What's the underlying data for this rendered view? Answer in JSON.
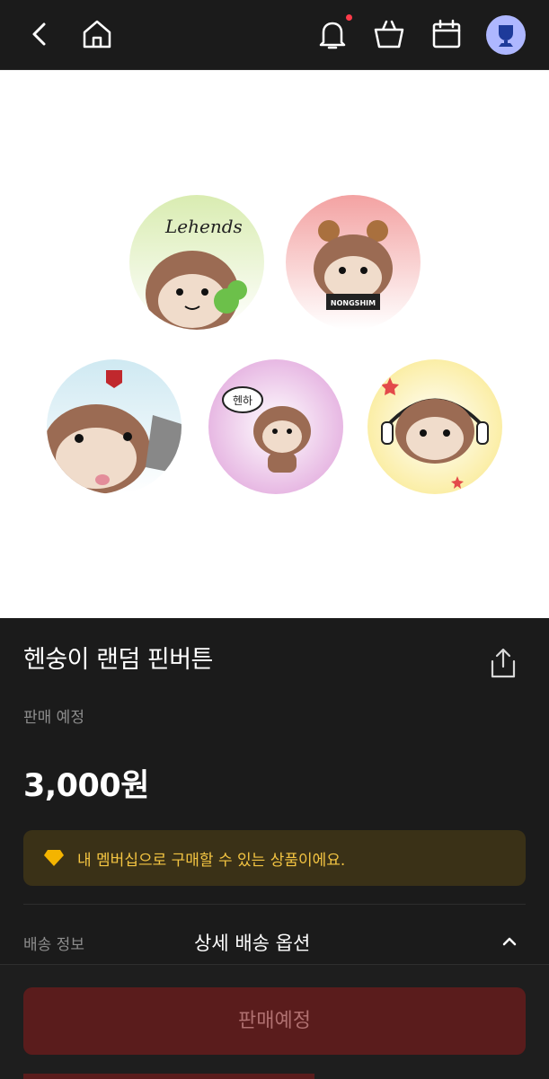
{
  "header": {
    "icons": [
      "back-icon",
      "home-icon",
      "bell-icon",
      "shopping-bag-icon",
      "calendar-icon",
      "avatar"
    ]
  },
  "product": {
    "title": "헨숭이 랜덤 핀버튼",
    "sale_status": "판매 예정",
    "price": "3,000원",
    "membership_notice": "내 멤버십으로 구매할 수 있는 상품이에요.",
    "badge_texts": [
      "Lehends",
      "NONGSHIM",
      "헨하"
    ]
  },
  "shipping": {
    "label": "배송 정보",
    "option": "상세 배송 옵션"
  },
  "cta": {
    "label": "판매예정"
  },
  "colors": {
    "background": "#1b1b1b",
    "notice_bg": "#3a3117",
    "notice_text": "#f4c542",
    "button_bg": "#5a1c1c",
    "button_text": "#b07070",
    "notification_dot": "#ff3b4a",
    "avatar_bg": "#aeb7ff"
  }
}
